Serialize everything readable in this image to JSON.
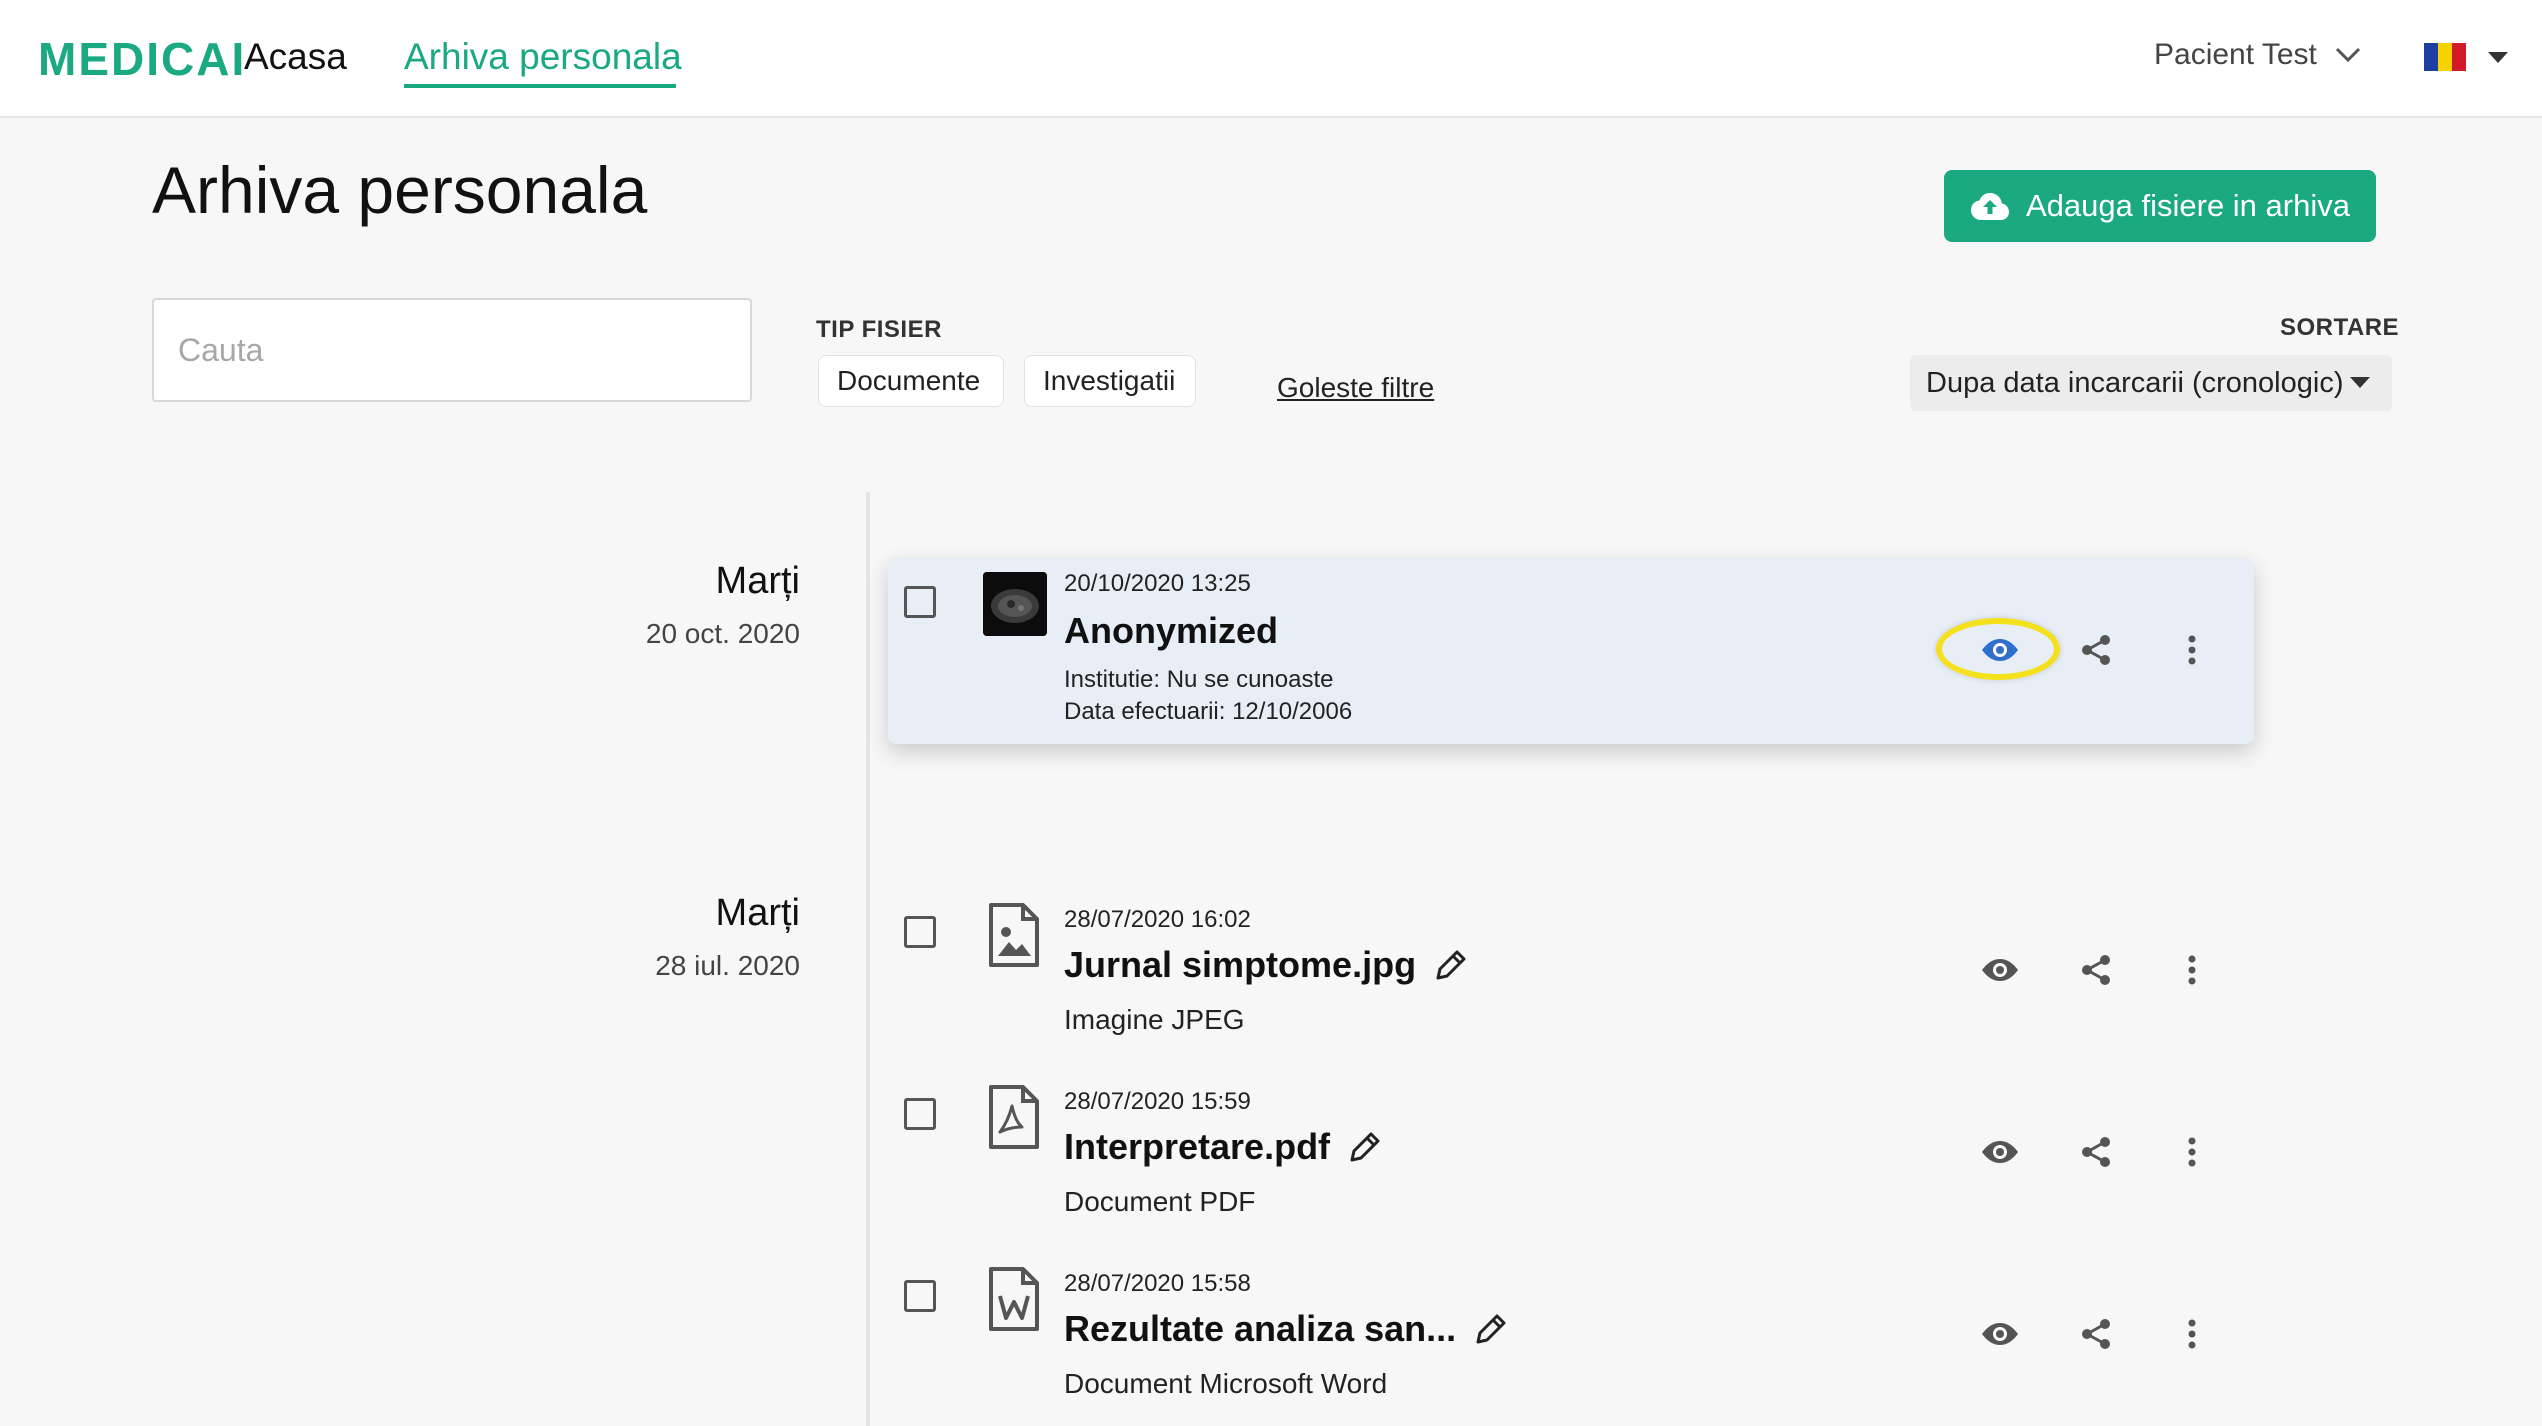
{
  "nav": {
    "logo": "MEDICAI",
    "home": "Acasa",
    "archive": "Arhiva personala",
    "user": "Pacient Test"
  },
  "header": {
    "title": "Arhiva personala",
    "upload_label": "Adauga fisiere in arhiva"
  },
  "filters": {
    "search_placeholder": "Cauta",
    "file_type_label": "TIP FISIER",
    "chip_documents": "Documente",
    "chip_investigations": "Investigatii",
    "clear": "Goleste filtre",
    "sort_label": "SORTARE",
    "sort_value": "Dupa data incarcarii (cronologic)"
  },
  "groups": [
    {
      "day": "Marți",
      "date": "20 oct. 2020",
      "files": [
        {
          "timestamp": "20/10/2020 13:25",
          "name": "Anonymized",
          "institution": "Institutie: Nu se cunoaste",
          "performed": "Data efectuarii: 12/10/2006"
        }
      ]
    },
    {
      "day": "Marți",
      "date": "28 iul. 2020",
      "files": [
        {
          "timestamp": "28/07/2020 16:02",
          "name": "Jurnal simptome.jpg",
          "type": "Imagine JPEG"
        },
        {
          "timestamp": "28/07/2020 15:59",
          "name": "Interpretare.pdf",
          "type": "Document PDF"
        },
        {
          "timestamp": "28/07/2020 15:58",
          "name": "Rezultate analiza san...",
          "type": "Document Microsoft Word"
        }
      ]
    }
  ],
  "colors": {
    "brand": "#1aa980",
    "highlight": "#f4e01c",
    "view_active": "#2f6fd0"
  },
  "icons": {
    "upload": "cloud-upload-icon",
    "view": "eye-icon",
    "share": "share-icon",
    "more": "more-vertical-icon",
    "edit": "pencil-icon",
    "image": "image-file-icon",
    "pdf": "pdf-file-icon",
    "word": "word-file-icon",
    "flag": "romania-flag-icon"
  }
}
